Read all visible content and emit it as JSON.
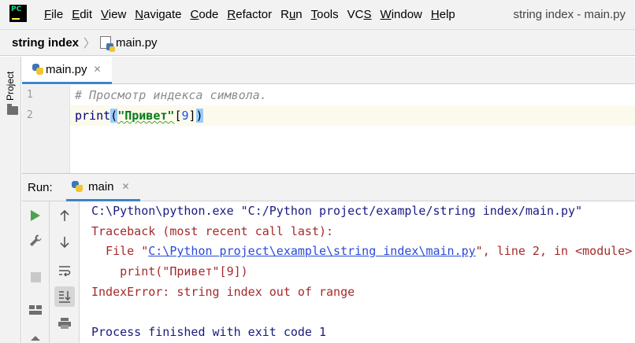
{
  "app": {
    "logo_text": "PC",
    "window_title": "string index - main.py"
  },
  "menu": [
    {
      "label": "File",
      "mnemonic": "F",
      "rest": "ile"
    },
    {
      "label": "Edit",
      "mnemonic": "E",
      "rest": "dit"
    },
    {
      "label": "View",
      "mnemonic": "V",
      "rest": "iew"
    },
    {
      "label": "Navigate",
      "mnemonic": "N",
      "rest": "avigate"
    },
    {
      "label": "Code",
      "mnemonic": "C",
      "rest": "ode"
    },
    {
      "label": "Refactor",
      "mnemonic": "R",
      "rest": "efactor"
    },
    {
      "label": "Run",
      "pre": "R",
      "mnemonic": "u",
      "rest": "n"
    },
    {
      "label": "Tools",
      "mnemonic": "T",
      "rest": "ools"
    },
    {
      "label": "VCS",
      "pre": "VC",
      "mnemonic": "S",
      "rest": ""
    },
    {
      "label": "Window",
      "mnemonic": "W",
      "rest": "indow"
    },
    {
      "label": "Help",
      "mnemonic": "H",
      "rest": "elp"
    }
  ],
  "breadcrumb": {
    "project": "string index",
    "separator": "〉",
    "file": "main.py"
  },
  "left_strip": {
    "project_tab_label": "Project"
  },
  "editor_tab": {
    "label": "main.py",
    "close": "✕"
  },
  "editor": {
    "lines": [
      {
        "number": "1",
        "comment": "# Просмотр индекса символа."
      },
      {
        "number": "2",
        "builtin": "print",
        "open_paren": "(",
        "string": "\"Привет\"",
        "open_bracket": "[",
        "index": "9",
        "close_bracket": "]",
        "close_paren": ")"
      }
    ]
  },
  "run_panel": {
    "label": "Run:",
    "tab_label": "main",
    "close": "✕"
  },
  "console": {
    "command": "C:\\Python\\python.exe \"C:/Python project/example/string index/main.py\"",
    "traceback_header": "Traceback (most recent call last):",
    "file_prefix": "  File \"",
    "file_link": "C:\\Python project\\example\\string index\\main.py",
    "file_suffix": "\", line 2, in <module>",
    "code_line": "    print(\"Привет\"[9])",
    "error": "IndexError: string index out of range",
    "exit": "Process finished with exit code 1"
  },
  "colors": {
    "accent": "#4083c9",
    "error_text": "#a52a2a",
    "link": "#2a4bd7",
    "run_green": "#4fa24f"
  }
}
